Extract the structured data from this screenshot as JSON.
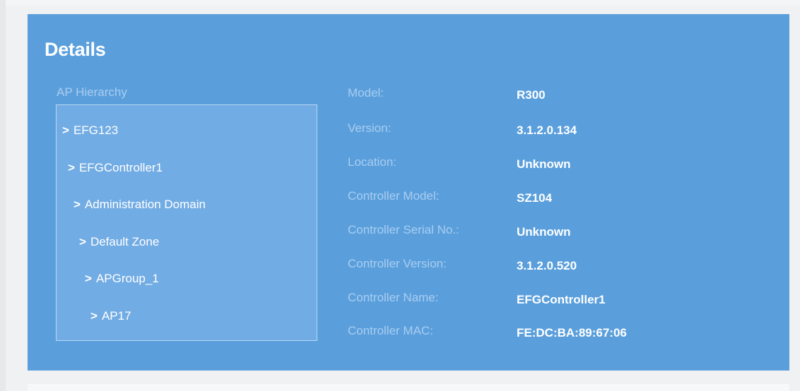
{
  "details": {
    "title": "Details",
    "hierarchy_label": "AP Hierarchy",
    "tree": [
      {
        "label": "EFG123"
      },
      {
        "label": "EFGController1"
      },
      {
        "label": "Administration Domain"
      },
      {
        "label": "Default Zone"
      },
      {
        "label": "APGroup_1"
      },
      {
        "label": "AP17"
      }
    ],
    "fields": [
      {
        "label": "Model:",
        "value": "R300"
      },
      {
        "label": "Version:",
        "value": "3.1.2.0.134"
      },
      {
        "label": "Location:",
        "value": "Unknown"
      },
      {
        "label": "Controller Model:",
        "value": "SZ104"
      },
      {
        "label": "Controller Serial No.:",
        "value": "Unknown"
      },
      {
        "label": "Controller Version:",
        "value": "3.1.2.0.520"
      },
      {
        "label": "Controller Name:",
        "value": "EFGController1"
      },
      {
        "label": "Controller MAC:",
        "value": "FE:DC:BA:89:67:06"
      }
    ],
    "tree_chevron": ">"
  },
  "colors": {
    "card_background": "#5a9fdc",
    "hierarchy_box": "#72ace4",
    "label_text": "#a9cdf0",
    "value_text": "#ffffff"
  }
}
